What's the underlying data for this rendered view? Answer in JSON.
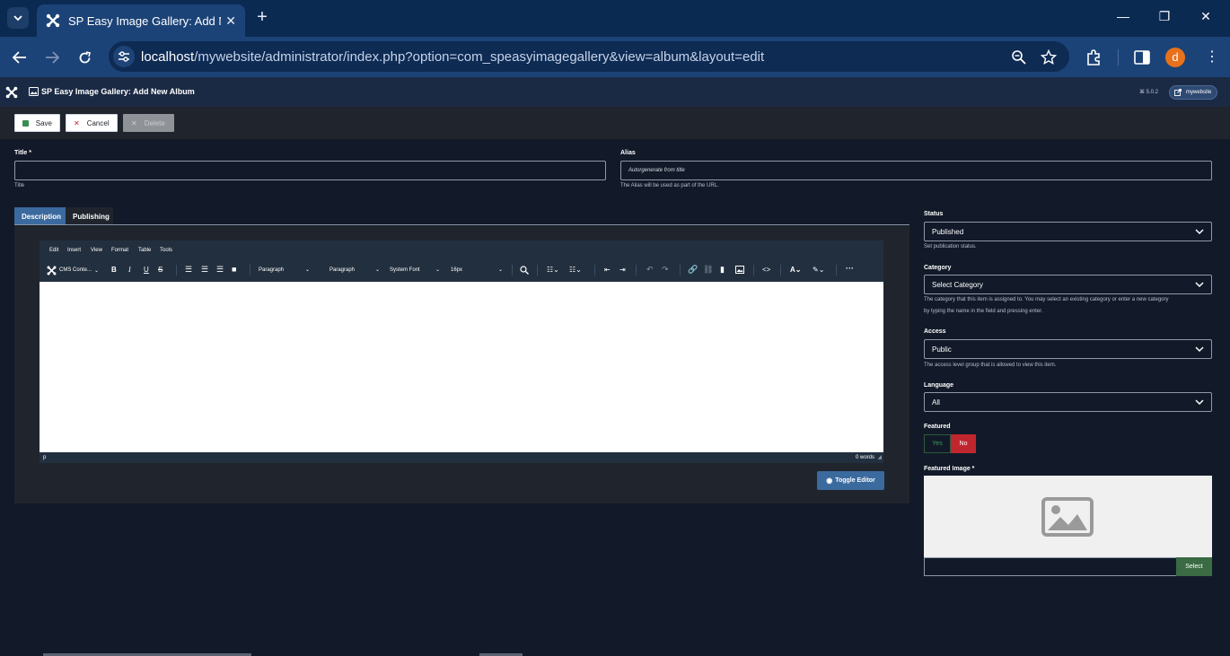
{
  "browser": {
    "tab_title": "SP Easy Image Gallery: Add New Album",
    "url_host": "localhost",
    "url_path": "/mywebsite/administrator/index.php?option=com_speasyimagegallery&view=album&layout=edit",
    "profile_initial": "d",
    "colors": {
      "tabstrip": "#0b2a52",
      "toolbar": "#1c4377",
      "avatar": "#e8711c"
    }
  },
  "header": {
    "page_title": "SP Easy Image Gallery: Add New Album",
    "version": "⌘ 5.0.2",
    "site_button": "mywebsite"
  },
  "toolbar": {
    "save_label": "Save",
    "cancel_label": "Cancel",
    "delete_label": "Delete"
  },
  "form": {
    "title_label": "Title *",
    "title_value": "",
    "title_hint": "Title",
    "alias_label": "Alias",
    "alias_placeholder": "Autorgenerate from title",
    "alias_hint": "The Alias will be used as part of the URL."
  },
  "tabs": [
    {
      "label": "Description",
      "active": true
    },
    {
      "label": "Publishing",
      "active": false
    }
  ],
  "editor": {
    "menu": [
      "Edit",
      "Insert",
      "View",
      "Format",
      "Table",
      "Tools"
    ],
    "cms_content": "CMS Conte...",
    "block_format_1": "Paragraph",
    "block_format_2": "Paragraph",
    "font_family": "System Font",
    "font_size": "16px",
    "path": "p",
    "word_count": "0 words",
    "toggle_label": "Toggle Editor"
  },
  "sidebar": {
    "status_label": "Status",
    "status_value": "Published",
    "status_hint": "Set publication status.",
    "category_label": "Category",
    "category_value": "Select Category",
    "category_hint_1": "The category that this item is assigned to. You may select an existing category or enter a new category",
    "category_hint_2": "by typing the name in the field and pressing enter.",
    "access_label": "Access",
    "access_value": "Public",
    "access_hint": "The access level group that is allowed to view this item.",
    "language_label": "Language",
    "language_value": "All",
    "featured_label": "Featured",
    "featured_yes": "Yes",
    "featured_no": "No",
    "featured_selected": "No",
    "featured_image_label": "Featured Image *",
    "select_label": "Select"
  }
}
